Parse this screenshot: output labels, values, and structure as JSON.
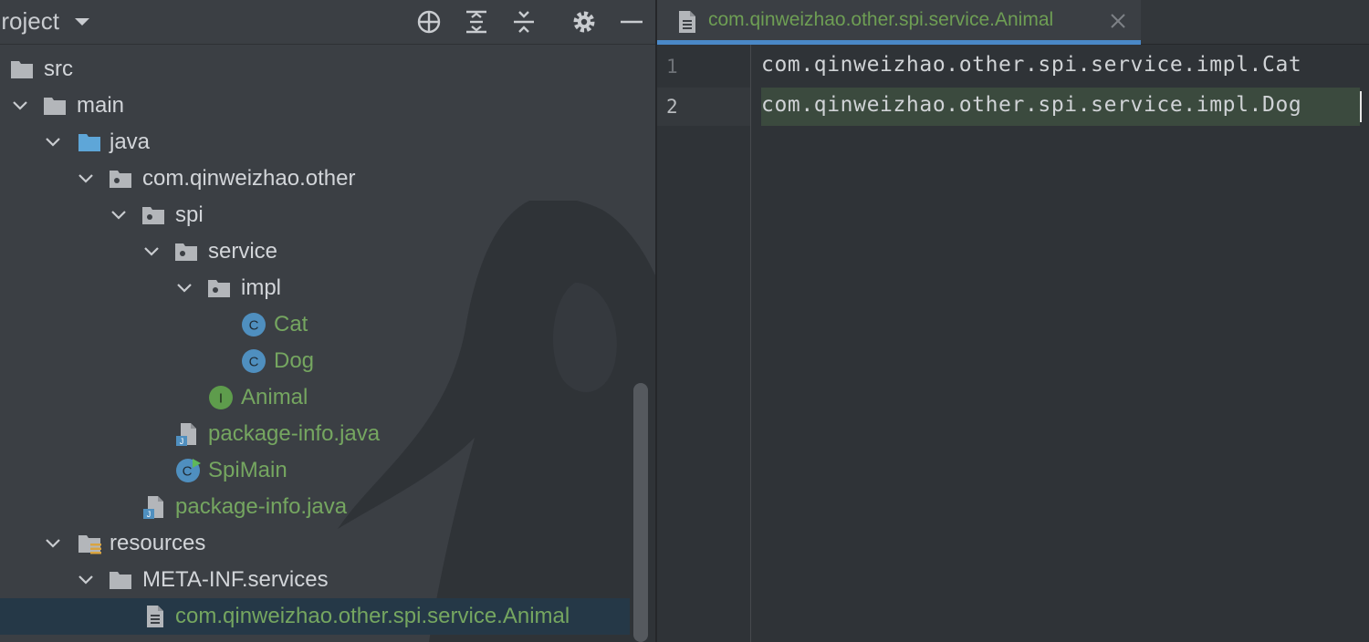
{
  "project_panel": {
    "title": "Project",
    "toolbar": [
      {
        "name": "locate-icon"
      },
      {
        "name": "expand-all-icon"
      },
      {
        "name": "collapse-all-icon"
      },
      {
        "name": "gear-icon"
      },
      {
        "name": "minimize-icon"
      }
    ],
    "tree": [
      {
        "label": "src"
      },
      {
        "label": "main"
      },
      {
        "label": "java"
      },
      {
        "label": "com.qinweizhao.other"
      },
      {
        "label": "spi"
      },
      {
        "label": "service"
      },
      {
        "label": "impl"
      },
      {
        "label": "Cat"
      },
      {
        "label": "Dog"
      },
      {
        "label": "Animal"
      },
      {
        "label": "package-info.java"
      },
      {
        "label": "SpiMain"
      },
      {
        "label": "package-info.java"
      },
      {
        "label": "resources"
      },
      {
        "label": "META-INF.services"
      },
      {
        "label": "com.qinweizhao.other.spi.service.Animal"
      }
    ],
    "class_icon_letter": "C",
    "interface_icon_letter": "I",
    "java_file_badge": "J"
  },
  "editor": {
    "tab": {
      "label": "com.qinweizhao.other.spi.service.Animal"
    },
    "lines": [
      {
        "number": "1",
        "text": "com.qinweizhao.other.spi.service.impl.Cat"
      },
      {
        "number": "2",
        "text": "com.qinweizhao.other.spi.service.impl.Dog"
      }
    ]
  },
  "colors": {
    "panel_bg": "#3b3f44",
    "editor_bg": "#2f3337",
    "folder_gray": "#b3b6ba",
    "source_folder_blue": "#5ea6d8",
    "class_icon_blue": "#4f8fbf",
    "interface_icon_green": "#5e9c4c",
    "modified_file_green": "#75a660",
    "selection_bg": "#253847",
    "tab_underline": "#4a88c7"
  }
}
